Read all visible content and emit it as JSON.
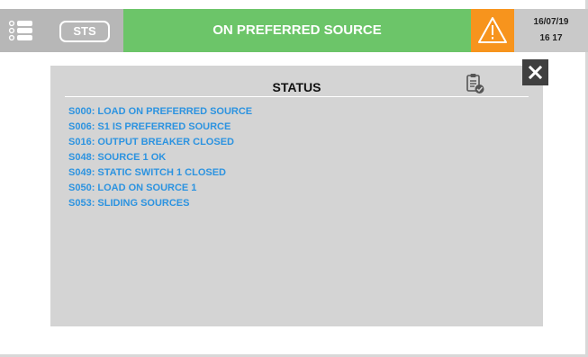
{
  "header": {
    "sts_label": "STS",
    "banner_text": "ON PREFERRED SOURCE",
    "date": "16/07/19",
    "time": "16 17",
    "colors": {
      "left_segment": "#b7b7b7",
      "banner": "#6cc569",
      "alarm": "#f7941d",
      "datetime": "#c9c9c9"
    },
    "icons": {
      "menu": "menu-list-icon",
      "alarm": "warning-triangle-icon"
    }
  },
  "status_panel": {
    "title": "STATUS",
    "clipboard_icon": "clipboard-check-icon",
    "close_icon": "close-icon",
    "items": [
      "S000: LOAD ON PREFERRED SOURCE",
      "S006: S1 IS PREFERRED SOURCE",
      "S016: OUTPUT BREAKER CLOSED",
      "S048: SOURCE 1 OK",
      "S049: STATIC SWITCH 1 CLOSED",
      "S050: LOAD ON SOURCE 1",
      "S053: SLIDING SOURCES"
    ],
    "item_color": "#2c93e0"
  }
}
